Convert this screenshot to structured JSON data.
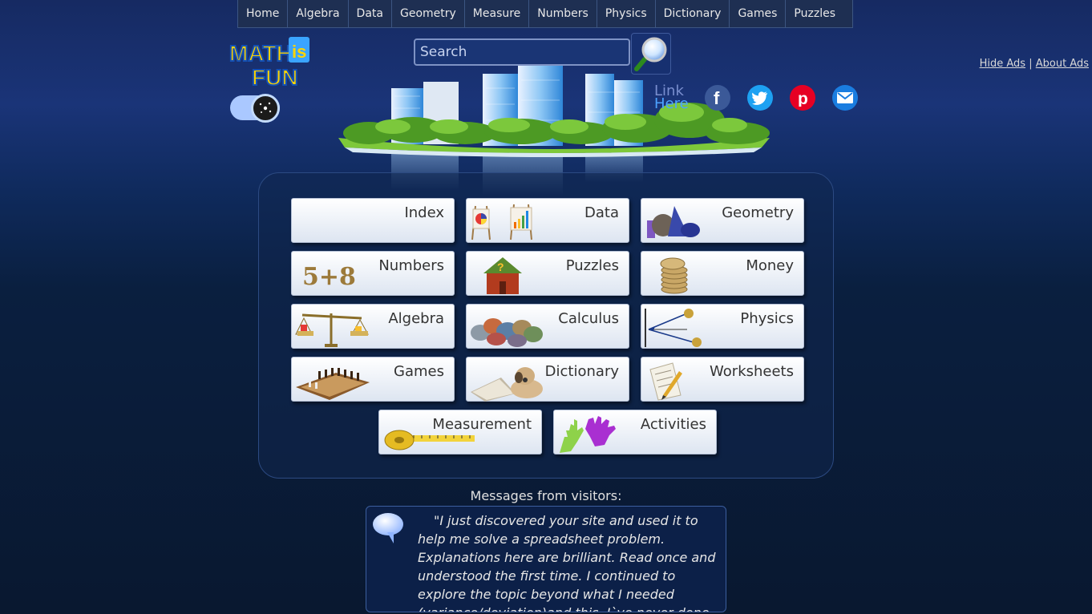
{
  "nav": [
    "Home",
    "Algebra",
    "Data",
    "Geometry",
    "Measure",
    "Numbers",
    "Physics",
    "Dictionary",
    "Games",
    "Puzzles"
  ],
  "logo": {
    "text_top": "MATH",
    "text_is": "is",
    "text_bottom": "FUN"
  },
  "search": {
    "placeholder": "Search"
  },
  "ads": {
    "hide": "Hide Ads",
    "separator": "|",
    "about": "About Ads"
  },
  "link_here": {
    "line1": "Link",
    "line2": "Here"
  },
  "social": [
    {
      "name": "facebook",
      "color": "#3b5998"
    },
    {
      "name": "twitter",
      "color": "#1da1f2"
    },
    {
      "name": "pinterest",
      "color": "#e60023"
    },
    {
      "name": "email",
      "color": "#1a7de0"
    }
  ],
  "tiles": {
    "index": "Index",
    "data": "Data",
    "geometry": "Geometry",
    "numbers": "Numbers",
    "puzzles": "Puzzles",
    "money": "Money",
    "algebra": "Algebra",
    "calculus": "Calculus",
    "physics": "Physics",
    "games": "Games",
    "dictionary": "Dictionary",
    "worksheets": "Worksheets",
    "measurement": "Measurement",
    "activities": "Activities"
  },
  "numbers_icon_text": "5+8",
  "messages": {
    "title": "Messages from visitors:",
    "text": "\"I just discovered your site and used it to help me solve a spreadsheet problem. Explanations here are brilliant. Read once and understood the first time. I continued to explore the topic beyond what I needed (variance/deviation)and this, I`ve never done with math. This will really be useful"
  }
}
